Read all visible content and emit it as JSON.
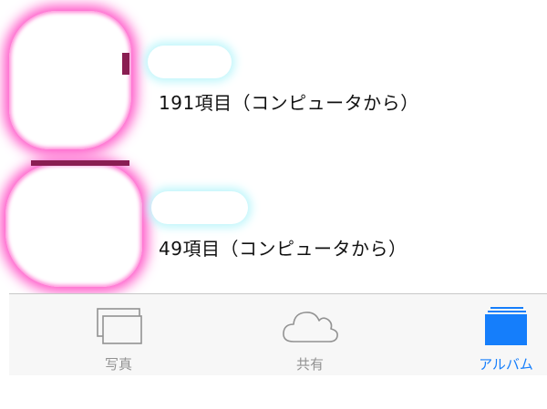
{
  "albums": [
    {
      "count_text": "191項目（コンピュータから）"
    },
    {
      "count_text": "49項目（コンピュータから）"
    }
  ],
  "tabbar": {
    "tabs": [
      {
        "label": "写真",
        "icon": "photos-icon",
        "selected": false
      },
      {
        "label": "共有",
        "icon": "cloud-icon",
        "selected": false
      },
      {
        "label": "アルバム",
        "icon": "albums-icon",
        "selected": true
      }
    ]
  },
  "colors": {
    "accent": "#157efb",
    "inactive": "#929292",
    "tabbar_bg": "#f7f7f7"
  }
}
